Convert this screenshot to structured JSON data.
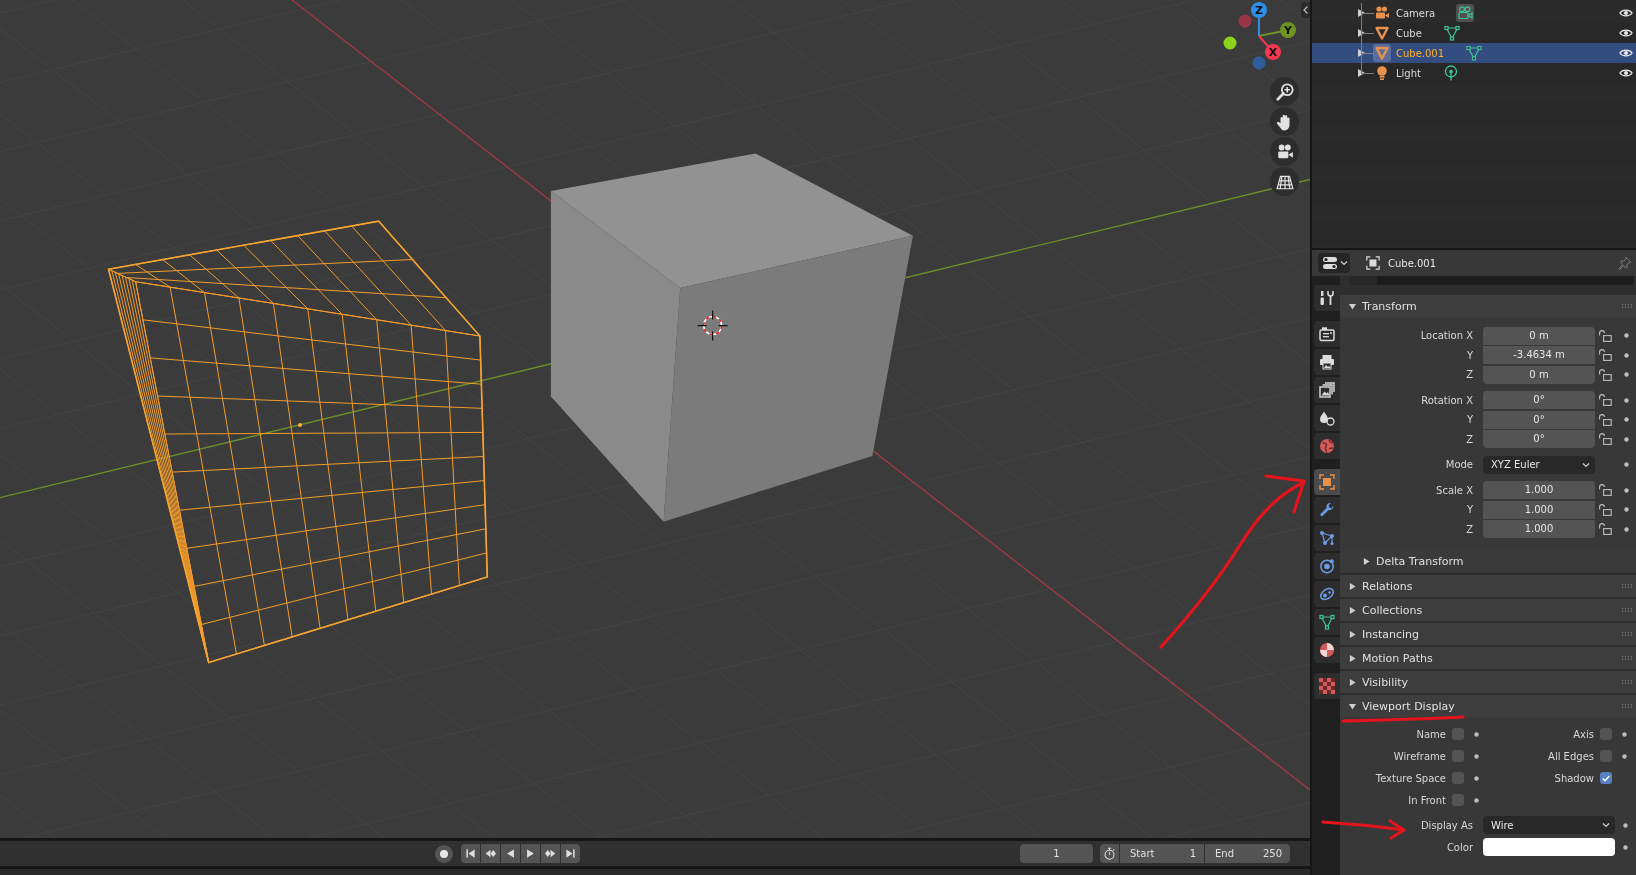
{
  "viewport": {
    "gizmo": [
      {
        "label": "Z",
        "color": "#2f8ee8",
        "negative": {
          "color": "#2d5f9e"
        }
      },
      {
        "label": "Y",
        "color": "#6f9424",
        "negative": {
          "color": "#8cd21c"
        }
      },
      {
        "label": "X",
        "color": "#f2374f",
        "negative": {
          "color": "#993647"
        }
      }
    ]
  },
  "outliner": {
    "rows": [
      {
        "name": "Camera",
        "kind": "camera",
        "selected": false,
        "object_active": false,
        "data_active": true,
        "visible": true
      },
      {
        "name": "Cube",
        "kind": "mesh",
        "selected": false,
        "object_active": false,
        "data_active": false,
        "visible": true
      },
      {
        "name": "Cube.001",
        "kind": "mesh",
        "selected": true,
        "object_active": true,
        "data_active": false,
        "visible": true
      },
      {
        "name": "Light",
        "kind": "light",
        "selected": false,
        "object_active": false,
        "data_active": false,
        "visible": true
      }
    ]
  },
  "properties": {
    "header": {
      "name": "Cube.001"
    },
    "tab_groups": [
      [
        {
          "kind": "tool",
          "selected": false
        }
      ],
      [
        {
          "kind": "render",
          "selected": false
        },
        {
          "kind": "output",
          "selected": false
        },
        {
          "kind": "view_layer",
          "selected": false
        },
        {
          "kind": "scene",
          "selected": false
        },
        {
          "kind": "world",
          "selected": false
        }
      ],
      [
        {
          "kind": "object",
          "selected": true
        },
        {
          "kind": "modifiers",
          "selected": false
        },
        {
          "kind": "particles",
          "selected": false
        },
        {
          "kind": "physics",
          "selected": false
        },
        {
          "kind": "constraints",
          "selected": false
        },
        {
          "kind": "data",
          "selected": false
        },
        {
          "kind": "material",
          "selected": false
        }
      ],
      [
        {
          "kind": "texture",
          "selected": false
        }
      ]
    ],
    "panels": [
      {
        "title": "Transform",
        "expanded": true,
        "groups": [
          [
            {
              "label": "Location X",
              "value": "0 m",
              "kind": "number",
              "locked": false
            },
            {
              "label": "Y",
              "value": "-3.4634 m",
              "kind": "number",
              "locked": false
            },
            {
              "label": "Z",
              "value": "0 m",
              "kind": "number",
              "locked": false
            }
          ],
          [
            {
              "label": "Rotation X",
              "value": "0°",
              "kind": "number",
              "locked": false
            },
            {
              "label": "Y",
              "value": "0°",
              "kind": "number",
              "locked": false
            },
            {
              "label": "Z",
              "value": "0°",
              "kind": "number",
              "locked": false
            }
          ],
          [
            {
              "label": "Mode",
              "value": "XYZ Euler",
              "kind": "dropdown"
            }
          ],
          [
            {
              "label": "Scale X",
              "value": "1.000",
              "kind": "number",
              "locked": false
            },
            {
              "label": "Y",
              "value": "1.000",
              "kind": "number",
              "locked": false
            },
            {
              "label": "Z",
              "value": "1.000",
              "kind": "number",
              "locked": false
            }
          ]
        ],
        "subpanels": [
          {
            "title": "Delta Transform",
            "expanded": false
          }
        ]
      },
      {
        "title": "Relations",
        "expanded": false
      },
      {
        "title": "Collections",
        "expanded": false
      },
      {
        "title": "Instancing",
        "expanded": false
      },
      {
        "title": "Motion Paths",
        "expanded": false
      },
      {
        "title": "Visibility",
        "expanded": false
      },
      {
        "title": "Viewport Display",
        "expanded": true,
        "checkboxes": [
          [
            {
              "label": "Name",
              "checked": false,
              "animatable": true
            },
            {
              "label": "Wireframe",
              "checked": false,
              "animatable": true
            },
            {
              "label": "Texture Space",
              "checked": false,
              "animatable": true
            },
            {
              "label": "In Front",
              "checked": false,
              "animatable": true
            }
          ],
          [
            {
              "label": "Axis",
              "checked": false,
              "animatable": true
            },
            {
              "label": "All Edges",
              "checked": false,
              "animatable": true
            },
            {
              "label": "Shadow",
              "checked": true,
              "animatable": false
            }
          ]
        ],
        "fields": [
          {
            "kind": "dropdown",
            "label": "Display As",
            "value": "Wire"
          },
          {
            "kind": "color",
            "label": "Color",
            "color": "#ffffff"
          }
        ]
      }
    ]
  },
  "timeline": {
    "frame": "1",
    "start": {
      "label": "Start",
      "value": "1"
    },
    "end": {
      "label": "End",
      "value": "250"
    }
  }
}
